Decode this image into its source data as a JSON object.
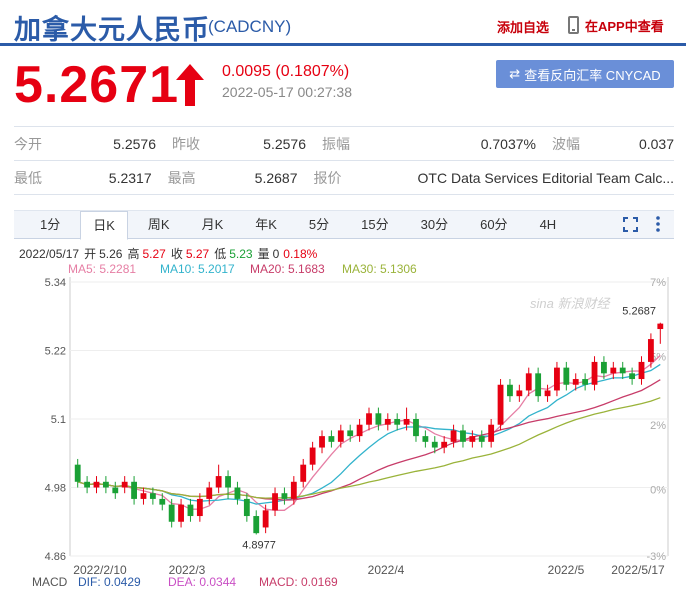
{
  "header": {
    "title": "加拿大元人民币",
    "code": "(CADCNY)",
    "add_fav": "添加自选",
    "app_view": "在APP中查看"
  },
  "quote": {
    "price": "5.2671",
    "change": "0.0095 (0.1807%)",
    "timestamp": "2022-05-17 00:27:38",
    "reverse_label": "查看反向汇率 CNYCAD"
  },
  "stats": {
    "open_label": "今开",
    "open": "5.2576",
    "prev_close_label": "昨收",
    "prev_close": "5.2576",
    "amplitude_label": "振幅",
    "amplitude": "0.7037%",
    "wave_label": "波幅",
    "wave": "0.037",
    "low_label": "最低",
    "low": "5.2317",
    "high_label": "最高",
    "high": "5.2687",
    "quote_label": "报价",
    "quote_source": "OTC Data Services Editorial Team Calc..."
  },
  "tabs": [
    "1分",
    "日K",
    "周K",
    "月K",
    "年K",
    "5分",
    "15分",
    "30分",
    "60分",
    "4H"
  ],
  "active_tab": "日K",
  "info_line": {
    "date": "2022/05/17",
    "open_lbl": "开",
    "open": "5.26",
    "high_lbl": "高",
    "high": "5.27",
    "close_lbl": "收",
    "close": "5.27",
    "low_lbl": "低",
    "low": "5.23",
    "vol_lbl": "量",
    "vol": "0",
    "pct": "0.18%"
  },
  "ma_line": {
    "ma5": "MA5: 5.2281",
    "ma10": "MA10: 5.2017",
    "ma20": "MA20: 5.1683",
    "ma30": "MA30: 5.1306"
  },
  "macd_line": {
    "macd_lbl": "MACD",
    "dif": "DIF: 0.0429",
    "dea": "DEA: 0.0344",
    "macd": "MACD: 0.0169"
  },
  "watermark": "sina 新浪财经",
  "colors": {
    "up": "#e60012",
    "down": "#1aa035",
    "ma5": "#e67ea4",
    "ma10": "#32b3cc",
    "ma20": "#c73c69",
    "ma30": "#9ab33a",
    "accent": "#2b5ba8"
  },
  "chart_data": {
    "type": "candlestick",
    "y_ticks": [
      "5.34",
      "5.22",
      "5.1",
      "4.98",
      "4.86"
    ],
    "y_range": [
      4.86,
      5.34
    ],
    "pct_ticks": [
      "7%",
      "5%",
      "2%",
      "0%",
      "-3%"
    ],
    "x_labels": [
      "2022/2/10",
      "2022/3",
      "2022/4",
      "2022/5",
      "2022/5/17"
    ],
    "high_label": "5.2687",
    "low_label": "4.8977",
    "candles": [
      [
        5.02,
        4.99,
        5.03,
        4.98
      ],
      [
        4.99,
        4.98,
        5.0,
        4.97
      ],
      [
        4.98,
        4.99,
        5.0,
        4.97
      ],
      [
        4.99,
        4.98,
        5.0,
        4.97
      ],
      [
        4.98,
        4.97,
        4.99,
        4.96
      ],
      [
        4.98,
        4.99,
        5.0,
        4.97
      ],
      [
        4.99,
        4.96,
        5.0,
        4.95
      ],
      [
        4.96,
        4.97,
        4.98,
        4.95
      ],
      [
        4.97,
        4.96,
        4.98,
        4.95
      ],
      [
        4.96,
        4.95,
        4.97,
        4.94
      ],
      [
        4.95,
        4.92,
        4.96,
        4.91
      ],
      [
        4.92,
        4.95,
        4.96,
        4.91
      ],
      [
        4.95,
        4.93,
        4.96,
        4.92
      ],
      [
        4.93,
        4.96,
        4.97,
        4.92
      ],
      [
        4.96,
        4.98,
        4.99,
        4.95
      ],
      [
        4.98,
        5.0,
        5.02,
        4.97
      ],
      [
        5.0,
        4.98,
        5.01,
        4.96
      ],
      [
        4.98,
        4.96,
        4.99,
        4.95
      ],
      [
        4.96,
        4.93,
        4.97,
        4.92
      ],
      [
        4.93,
        4.9,
        4.94,
        4.8977
      ],
      [
        4.91,
        4.94,
        4.95,
        4.9
      ],
      [
        4.94,
        4.97,
        4.98,
        4.93
      ],
      [
        4.97,
        4.96,
        4.98,
        4.95
      ],
      [
        4.96,
        4.99,
        5.0,
        4.95
      ],
      [
        4.99,
        5.02,
        5.03,
        4.98
      ],
      [
        5.02,
        5.05,
        5.06,
        5.01
      ],
      [
        5.05,
        5.07,
        5.08,
        5.04
      ],
      [
        5.07,
        5.06,
        5.08,
        5.05
      ],
      [
        5.06,
        5.08,
        5.09,
        5.05
      ],
      [
        5.08,
        5.07,
        5.09,
        5.06
      ],
      [
        5.07,
        5.09,
        5.1,
        5.06
      ],
      [
        5.09,
        5.11,
        5.12,
        5.08
      ],
      [
        5.11,
        5.09,
        5.12,
        5.08
      ],
      [
        5.09,
        5.1,
        5.11,
        5.08
      ],
      [
        5.1,
        5.09,
        5.11,
        5.08
      ],
      [
        5.09,
        5.1,
        5.12,
        5.08
      ],
      [
        5.1,
        5.07,
        5.11,
        5.06
      ],
      [
        5.07,
        5.06,
        5.08,
        5.05
      ],
      [
        5.06,
        5.05,
        5.07,
        5.04
      ],
      [
        5.05,
        5.06,
        5.07,
        5.04
      ],
      [
        5.06,
        5.08,
        5.09,
        5.05
      ],
      [
        5.08,
        5.06,
        5.09,
        5.05
      ],
      [
        5.06,
        5.07,
        5.08,
        5.05
      ],
      [
        5.07,
        5.06,
        5.08,
        5.05
      ],
      [
        5.06,
        5.09,
        5.1,
        5.05
      ],
      [
        5.09,
        5.16,
        5.17,
        5.08
      ],
      [
        5.16,
        5.14,
        5.17,
        5.13
      ],
      [
        5.14,
        5.15,
        5.16,
        5.13
      ],
      [
        5.15,
        5.18,
        5.19,
        5.14
      ],
      [
        5.18,
        5.14,
        5.19,
        5.13
      ],
      [
        5.14,
        5.15,
        5.16,
        5.13
      ],
      [
        5.15,
        5.19,
        5.2,
        5.14
      ],
      [
        5.19,
        5.16,
        5.2,
        5.15
      ],
      [
        5.16,
        5.17,
        5.18,
        5.15
      ],
      [
        5.17,
        5.16,
        5.18,
        5.15
      ],
      [
        5.16,
        5.2,
        5.21,
        5.15
      ],
      [
        5.2,
        5.18,
        5.21,
        5.17
      ],
      [
        5.18,
        5.19,
        5.2,
        5.17
      ],
      [
        5.19,
        5.18,
        5.2,
        5.17
      ],
      [
        5.18,
        5.17,
        5.19,
        5.16
      ],
      [
        5.17,
        5.2,
        5.21,
        5.16
      ],
      [
        5.2,
        5.24,
        5.25,
        5.19
      ],
      [
        5.2576,
        5.2671,
        5.2687,
        5.2317
      ]
    ]
  }
}
